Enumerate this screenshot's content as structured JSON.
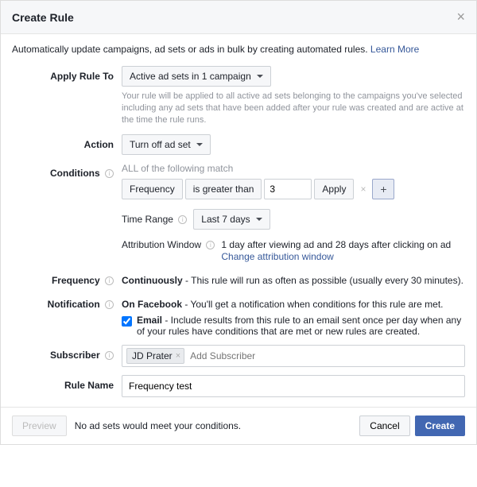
{
  "header": {
    "title": "Create Rule"
  },
  "intro": {
    "text": "Automatically update campaigns, ad sets or ads in bulk by creating automated rules. ",
    "link": "Learn More"
  },
  "applyRule": {
    "label": "Apply Rule To",
    "value": "Active ad sets in 1 campaign",
    "helper": "Your rule will be applied to all active ad sets belonging to the campaigns you've selected including any ad sets that have been added after your rule was created and are active at the time the rule runs."
  },
  "action": {
    "label": "Action",
    "value": "Turn off ad set"
  },
  "conditions": {
    "label": "Conditions",
    "allMatch": "ALL of the following match",
    "metric": "Frequency",
    "operator": "is greater than",
    "value": "3",
    "apply": "Apply",
    "timeRangeLabel": "Time Range",
    "timeRangeValue": "Last 7 days",
    "attributionLabel": "Attribution Window",
    "attributionText": "1 day after viewing ad and 28 days after clicking on ad",
    "attributionLink": "Change attribution window"
  },
  "frequency": {
    "label": "Frequency",
    "bold": "Continuously",
    "text": " - This rule will run as often as possible (usually every 30 minutes)."
  },
  "notification": {
    "label": "Notification",
    "fbBold": "On Facebook",
    "fbText": " - You'll get a notification when conditions for this rule are met.",
    "emailBold": "Email",
    "emailText": " - Include results from this rule to an email sent once per day when any of your rules have conditions that are met or new rules are created."
  },
  "subscriber": {
    "label": "Subscriber",
    "token": "JD Prater",
    "placeholder": "Add Subscriber"
  },
  "ruleName": {
    "label": "Rule Name",
    "value": "Frequency test"
  },
  "footer": {
    "preview": "Preview",
    "text": "No ad sets would meet your conditions.",
    "cancel": "Cancel",
    "create": "Create"
  }
}
